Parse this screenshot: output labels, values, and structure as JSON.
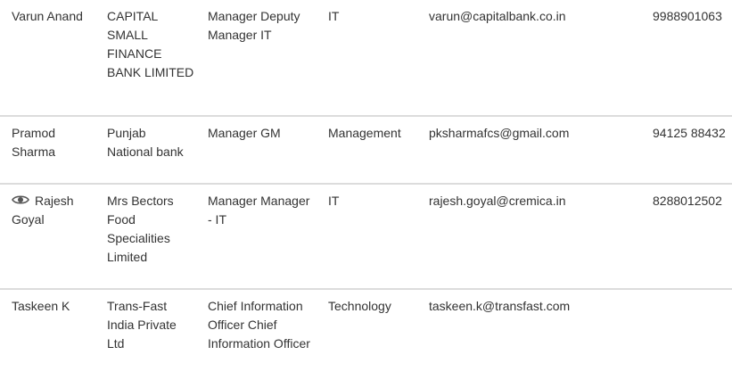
{
  "rows": [
    {
      "name": "Varun Anand",
      "company": "CAPITAL SMALL FINANCE BANK LIMITED",
      "title": "Manager Deputy Manager IT",
      "department": "IT",
      "email": "varun@capitalbank.co.in",
      "phone": "9988901063",
      "viewed": false
    },
    {
      "name": "Pramod Sharma",
      "company": "Punjab National bank",
      "title": "Manager GM",
      "department": "Management",
      "email": "pksharmafcs@gmail.com",
      "phone": "94125 88432",
      "viewed": false
    },
    {
      "name": "Rajesh Goyal",
      "company": "Mrs Bectors Food Specialities Limited",
      "title": "Manager Manager - IT",
      "department": "IT",
      "email": "rajesh.goyal@cremica.in",
      "phone": "8288012502",
      "viewed": true,
      "icon": "eye-icon"
    },
    {
      "name": "Taskeen K",
      "company": "Trans-Fast India Private Ltd",
      "title": "Chief Information Officer Chief Information Officer",
      "department": "Technology",
      "email": "taskeen.k@transfast.com",
      "phone": "",
      "viewed": false
    }
  ],
  "colors": {
    "text": "#333333",
    "divider": "#dcdcdc",
    "icon": "#555555"
  }
}
